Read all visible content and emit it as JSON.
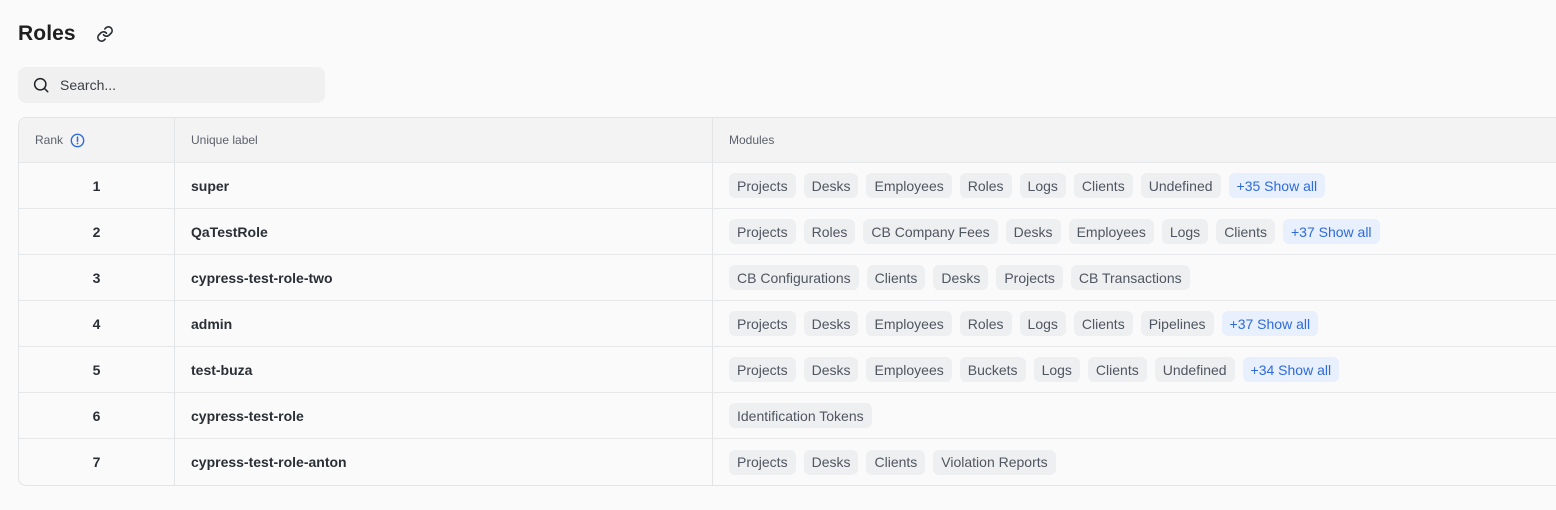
{
  "page": {
    "title": "Roles"
  },
  "search": {
    "placeholder": "Search..."
  },
  "table": {
    "columns": {
      "rank": "Rank",
      "label": "Unique label",
      "modules": "Modules"
    },
    "rows": [
      {
        "rank": "1",
        "label": "super",
        "modules": [
          "Projects",
          "Desks",
          "Employees",
          "Roles",
          "Logs",
          "Clients",
          "Undefined"
        ],
        "more": "+35 Show all"
      },
      {
        "rank": "2",
        "label": "QaTestRole",
        "modules": [
          "Projects",
          "Roles",
          "CB Company Fees",
          "Desks",
          "Employees",
          "Logs",
          "Clients"
        ],
        "more": "+37 Show all"
      },
      {
        "rank": "3",
        "label": "cypress-test-role-two",
        "modules": [
          "CB Configurations",
          "Clients",
          "Desks",
          "Projects",
          "CB Transactions"
        ],
        "more": ""
      },
      {
        "rank": "4",
        "label": "admin",
        "modules": [
          "Projects",
          "Desks",
          "Employees",
          "Roles",
          "Logs",
          "Clients",
          "Pipelines"
        ],
        "more": "+37 Show all"
      },
      {
        "rank": "5",
        "label": "test-buza",
        "modules": [
          "Projects",
          "Desks",
          "Employees",
          "Buckets",
          "Logs",
          "Clients",
          "Undefined"
        ],
        "more": "+34 Show all"
      },
      {
        "rank": "6",
        "label": "cypress-test-role",
        "modules": [
          "Identification Tokens"
        ],
        "more": ""
      },
      {
        "rank": "7",
        "label": "cypress-test-role-anton",
        "modules": [
          "Projects",
          "Desks",
          "Clients",
          "Violation Reports"
        ],
        "more": ""
      }
    ]
  },
  "icons": {
    "title_action": "link-icon",
    "search": "search-icon",
    "rank_info": "info-icon"
  },
  "colors": {
    "accent": "#2f6bd8",
    "chip_bg": "#eeeff1",
    "more_chip_bg": "#e8effd"
  }
}
